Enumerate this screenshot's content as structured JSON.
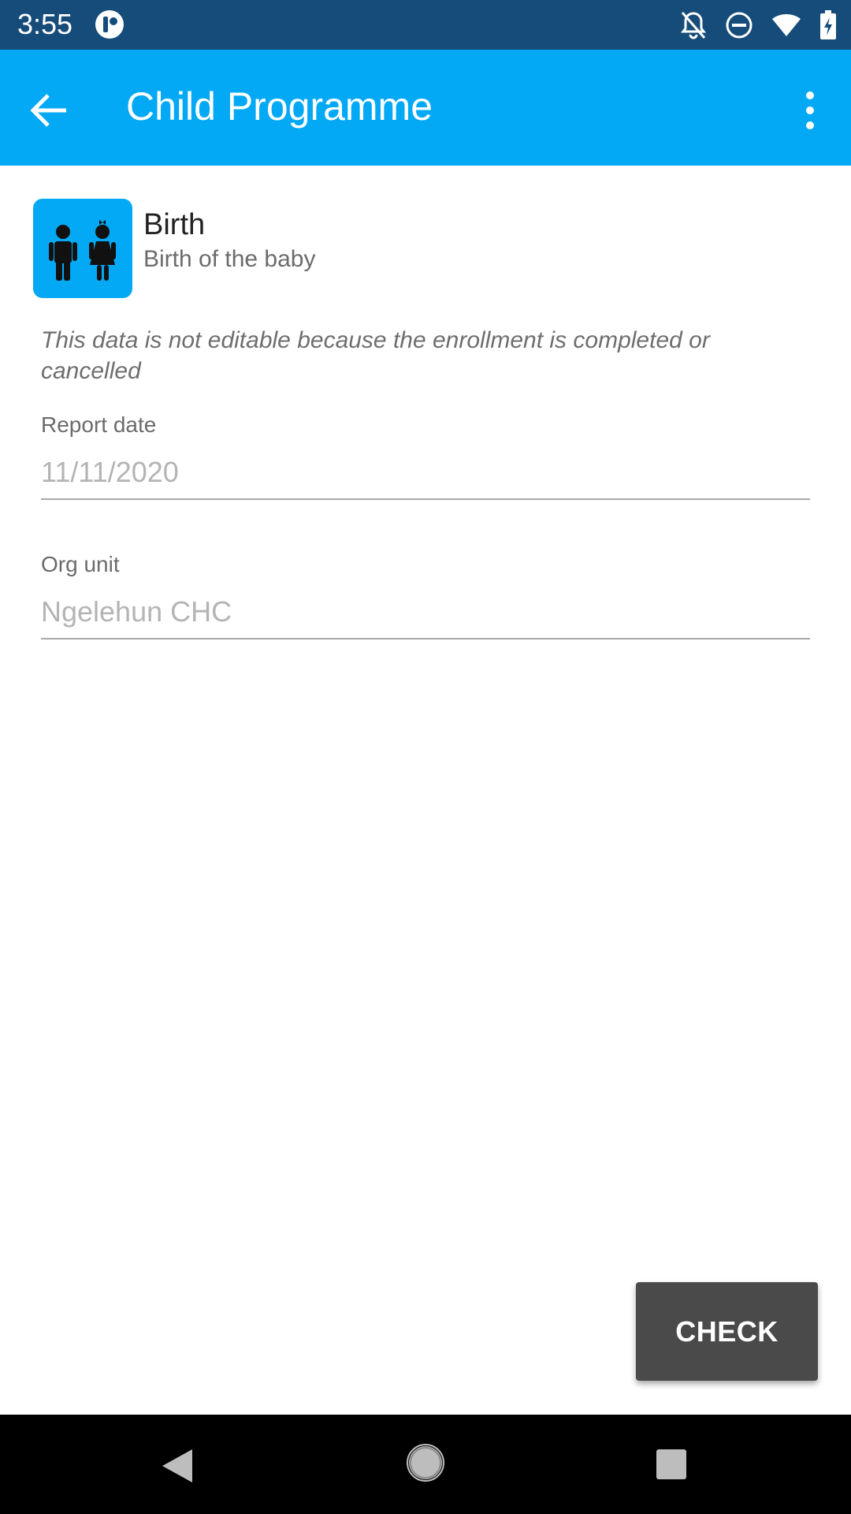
{
  "status_bar": {
    "time": "3:55",
    "icons": [
      "app-notification-icon",
      "bell-off-icon",
      "do-not-disturb-icon",
      "wifi-icon",
      "battery-charging-icon"
    ]
  },
  "app_bar": {
    "title": "Child Programme",
    "back_icon": "arrow-back-icon",
    "menu_icon": "more-vert-icon",
    "color": "#03a9f4"
  },
  "stage": {
    "title": "Birth",
    "subtitle": "Birth of the baby",
    "icon": "children-icon"
  },
  "notice": "This data is not editable because the enrollment is completed or cancelled",
  "fields": [
    {
      "label": "Report date",
      "value": "11/11/2020"
    },
    {
      "label": "Org unit",
      "value": "Ngelehun CHC"
    }
  ],
  "check_button": {
    "label": "CHECK"
  },
  "nav_bar": {
    "icons": [
      "nav-back-icon",
      "nav-home-icon",
      "nav-recents-icon"
    ]
  }
}
